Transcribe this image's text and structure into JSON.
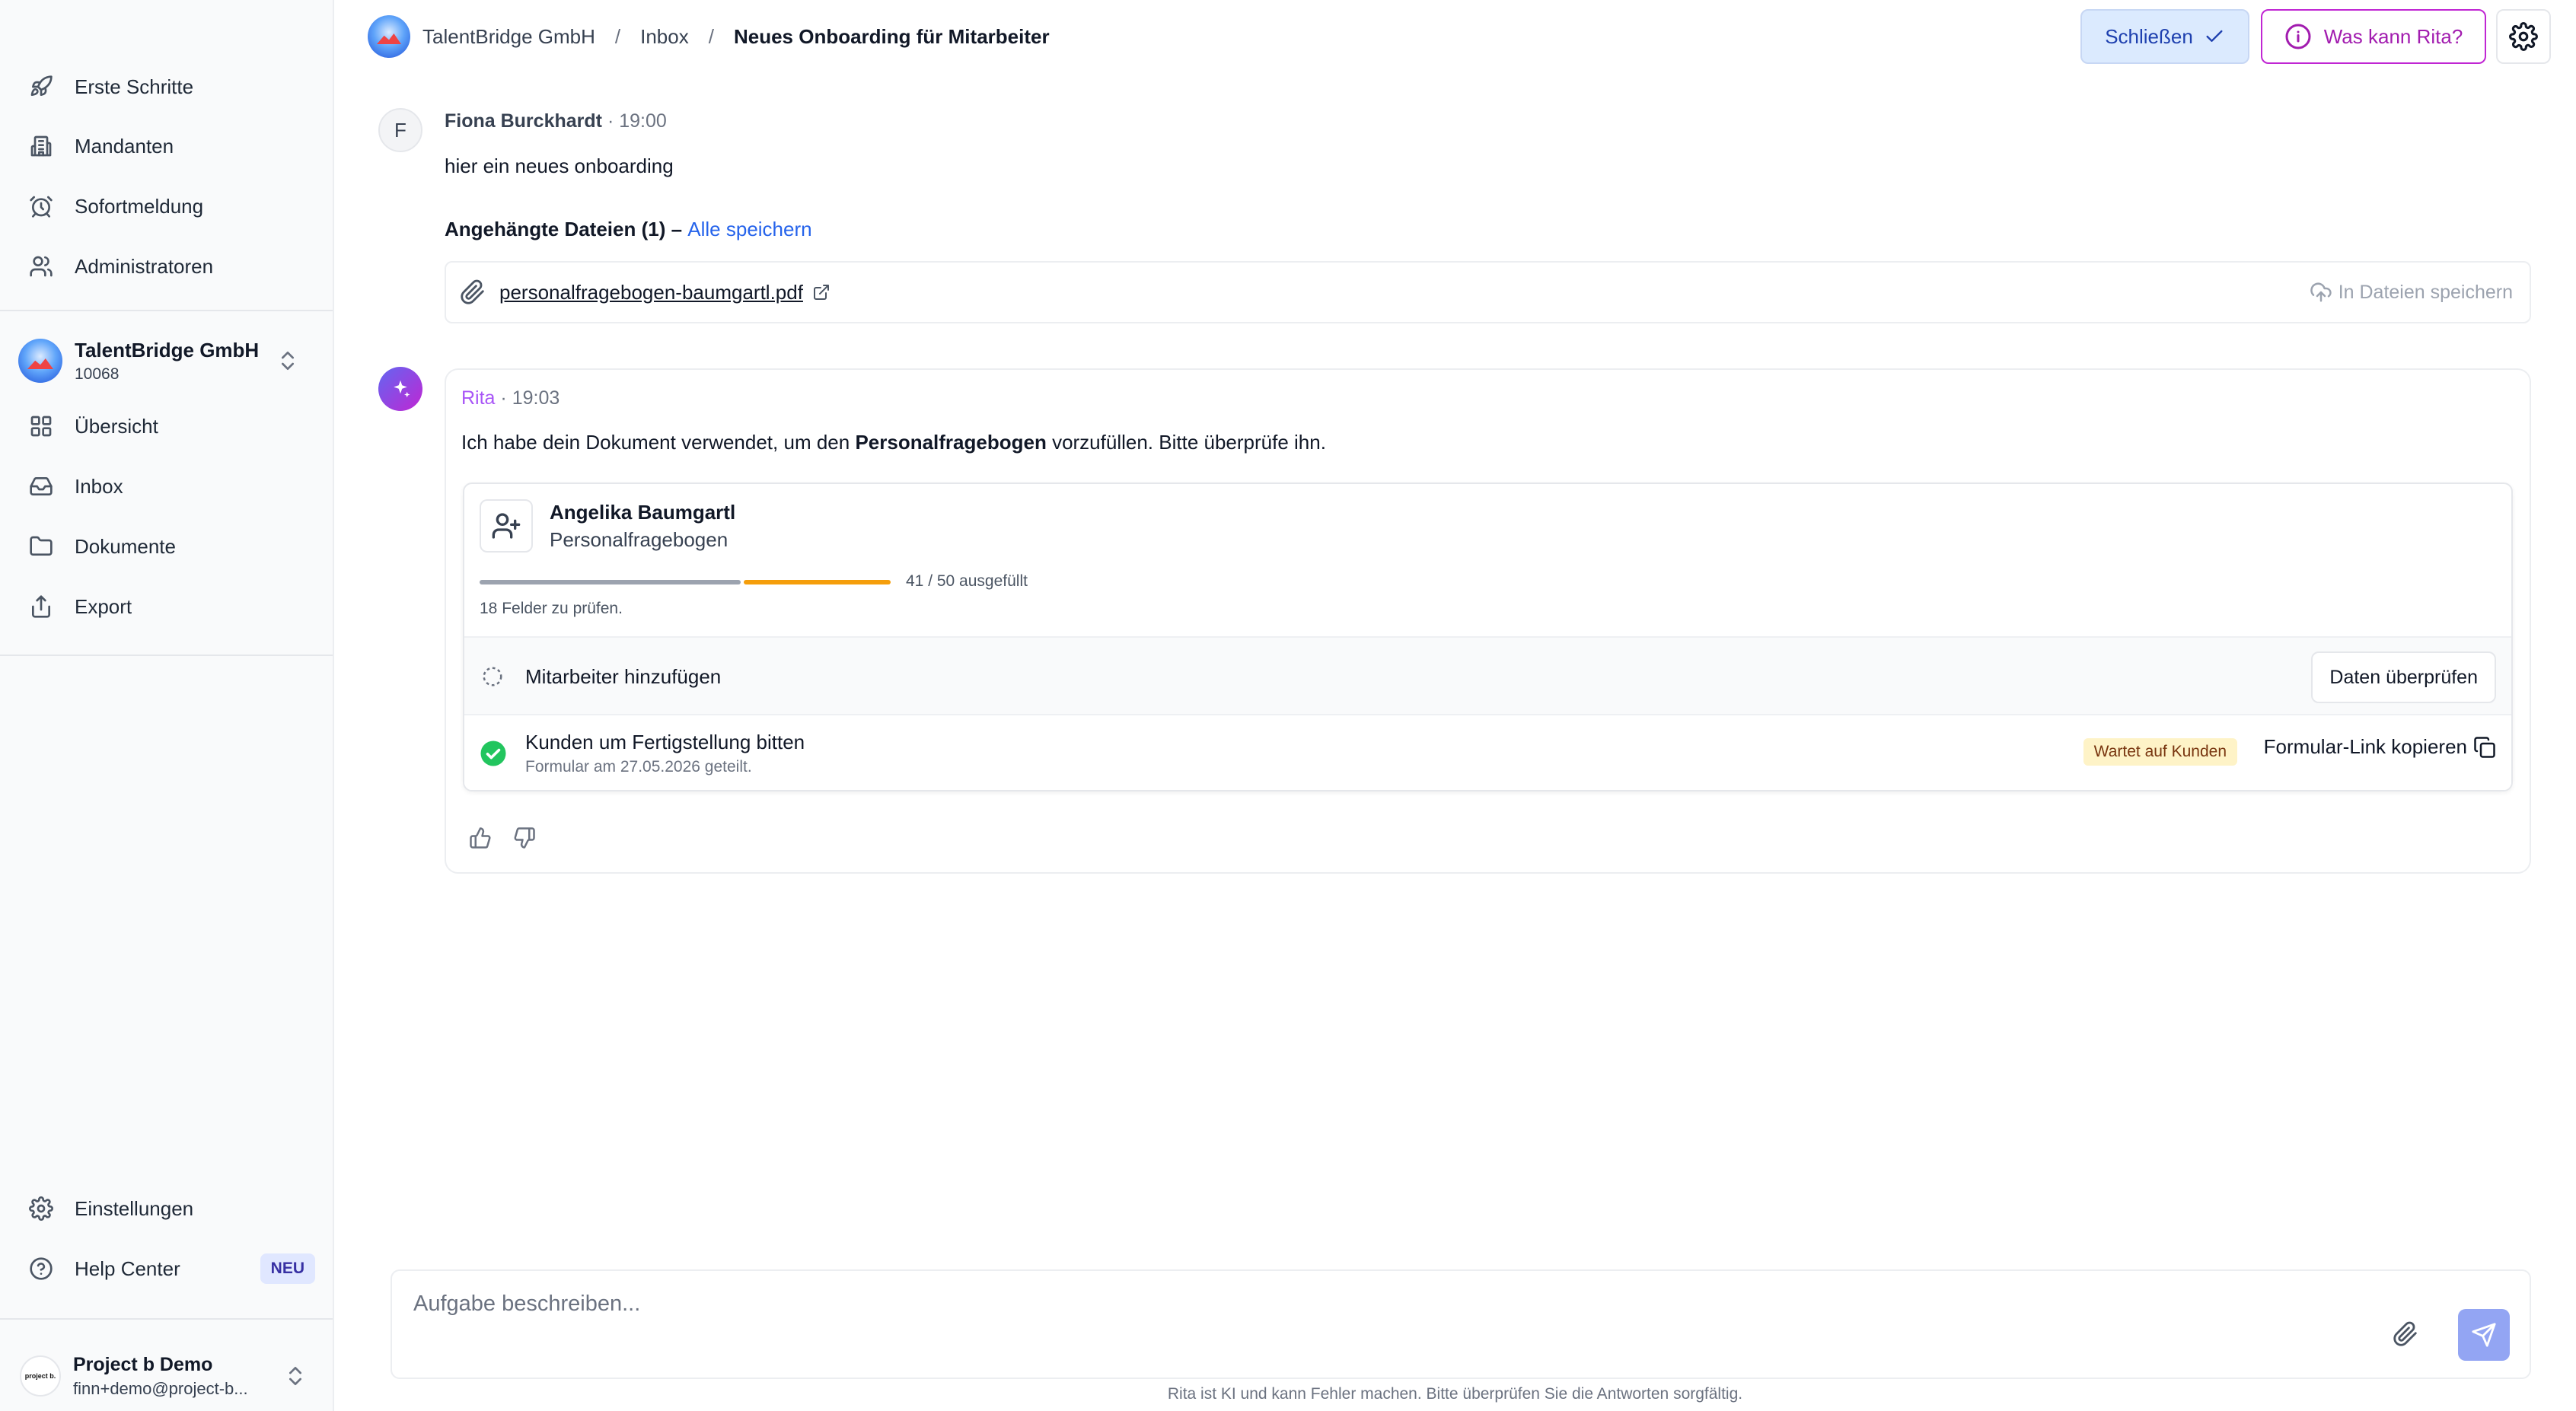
{
  "sidebar": {
    "top_items": [
      {
        "label": "Erste Schritte",
        "icon": "rocket-icon"
      },
      {
        "label": "Mandanten",
        "icon": "building-icon"
      },
      {
        "label": "Sofortmeldung",
        "icon": "alarm-clock-icon"
      },
      {
        "label": "Administratoren",
        "icon": "users-icon"
      }
    ],
    "org": {
      "name": "TalentBridge GmbH",
      "id": "10068"
    },
    "org_items": [
      {
        "label": "Übersicht",
        "icon": "grid-icon"
      },
      {
        "label": "Inbox",
        "icon": "inbox-icon"
      },
      {
        "label": "Dokumente",
        "icon": "folder-icon"
      },
      {
        "label": "Export",
        "icon": "share-icon"
      }
    ],
    "bottom_items": [
      {
        "label": "Einstellungen",
        "icon": "gear-icon"
      },
      {
        "label": "Help Center",
        "icon": "help-circle-icon",
        "badge": "NEU"
      }
    ],
    "user": {
      "name": "Project b Demo",
      "email": "finn+demo@project-b...",
      "logo_text": "project b."
    }
  },
  "header": {
    "breadcrumb": [
      "TalentBridge GmbH",
      "Inbox",
      "Neues Onboarding für Mitarbeiter"
    ],
    "separator": "/",
    "close_label": "Schließen",
    "rita_label": "Was kann Rita?"
  },
  "messages": {
    "fiona": {
      "initial": "F",
      "author": "Fiona Burckhardt",
      "time": "· 19:00",
      "text": "hier ein neues onboarding",
      "attachments_title": "Angehängte Dateien (1) – ",
      "save_all": "Alle speichern",
      "file_name": "personalfragebogen-baumgartl.pdf",
      "save_to_files": "In Dateien speichern"
    },
    "rita": {
      "author": "Rita",
      "time": "· 19:03",
      "text_before": "Ich habe dein Dokument verwendet, um den ",
      "text_bold": "Personalfragebogen",
      "text_after": " vorzufüllen. Bitte überprüfe ihn.",
      "card": {
        "person": "Angelika Baumgartl",
        "form": "Personalfragebogen",
        "progress_filled": 41,
        "progress_total": 50,
        "progress_text": "41 / 50 ausgefüllt",
        "review_hint": "18 Felder zu prüfen.",
        "step1": {
          "label": "Mitarbeiter hinzufügen",
          "button": "Daten überprüfen",
          "status": "pending"
        },
        "step2": {
          "label": "Kunden um Fertigstellung bitten",
          "sub": "Formular am 27.05.2026 geteilt.",
          "badge": "Wartet auf Kunden",
          "action": "Formular-Link kopieren",
          "status": "done"
        }
      }
    }
  },
  "composer": {
    "placeholder": "Aufgabe beschreiben...",
    "disclaimer": "Rita ist KI und kann Fehler machen. Bitte überprüfen Sie die Antworten sorgfältig."
  },
  "colors": {
    "accent": "#2563eb",
    "rita": "#a21caf",
    "progress_done": "#9ca3af",
    "progress_todo": "#f59e0b",
    "success": "#22c55e"
  }
}
